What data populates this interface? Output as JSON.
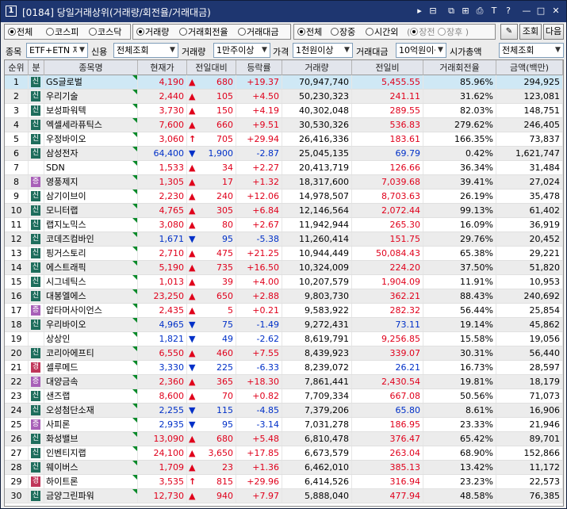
{
  "window": {
    "number": "1",
    "title": "[0184] 당일거래상위(거래량/회전율/거래대금)"
  },
  "toolbar_row1": {
    "market_options": [
      "전체",
      "코스피",
      "코스닥"
    ],
    "market_selected": 0,
    "sort_options": [
      "거래량",
      "거래회전율",
      "거래대금"
    ],
    "sort_selected": 0,
    "session_options": [
      "전체",
      "장중",
      "시간외"
    ],
    "session_selected": 0,
    "sub_session_options": [
      "장전",
      "장후"
    ],
    "query_button": "조회",
    "next_button": "다음"
  },
  "toolbar_row2": {
    "stock_label": "종목",
    "stock_value": "ETF+ETN 제",
    "credit_label": "신용",
    "credit_value": "전체조회",
    "volume_label": "거래량",
    "volume_value": "1만주이상",
    "price_label": "가격",
    "price_value": "1천원이상",
    "amount_label": "거래대금",
    "amount_value": "10억원이상",
    "cap_label": "시가총액",
    "cap_value": "전체조회"
  },
  "table": {
    "headers": [
      "순위",
      "분",
      "종목명",
      "현재가",
      "전일대비",
      "등락률",
      "거래량",
      "전일비",
      "거래회전율",
      "금액(백만)"
    ],
    "rows": [
      {
        "rank": "1",
        "type": "신",
        "name": "GS글로벌",
        "price": "4,190",
        "dir": "up",
        "change": "680",
        "rate": "+19.37",
        "volume": "70,947,740",
        "prev": "5,455.55",
        "turnover": "85.96%",
        "amount": "294,925"
      },
      {
        "rank": "2",
        "type": "신",
        "name": "우리기술",
        "price": "2,440",
        "dir": "up",
        "change": "105",
        "rate": "+4.50",
        "volume": "50,230,323",
        "prev": "241.11",
        "turnover": "31.62%",
        "amount": "123,081"
      },
      {
        "rank": "3",
        "type": "신",
        "name": "보성파워텍",
        "price": "3,730",
        "dir": "up",
        "change": "150",
        "rate": "+4.19",
        "volume": "40,302,048",
        "prev": "289.55",
        "turnover": "82.03%",
        "amount": "148,751"
      },
      {
        "rank": "4",
        "type": "신",
        "name": "엑셀세라퓨틱스",
        "price": "7,600",
        "dir": "up",
        "change": "660",
        "rate": "+9.51",
        "volume": "30,530,326",
        "prev": "536.83",
        "turnover": "279.62%",
        "amount": "246,405"
      },
      {
        "rank": "5",
        "type": "신",
        "name": "우정바이오",
        "price": "3,060",
        "dir": "uplim",
        "change": "705",
        "rate": "+29.94",
        "volume": "26,416,336",
        "prev": "183.61",
        "turnover": "166.35%",
        "amount": "73,837"
      },
      {
        "rank": "6",
        "type": "신",
        "name": "삼성전자",
        "price": "64,400",
        "dir": "down",
        "change": "1,900",
        "rate": "-2.87",
        "volume": "25,045,135",
        "prev": "69.79",
        "turnover": "0.42%",
        "amount": "1,621,747"
      },
      {
        "rank": "7",
        "type": "",
        "name": "SDN",
        "price": "1,533",
        "dir": "up",
        "change": "34",
        "rate": "+2.27",
        "volume": "20,413,719",
        "prev": "126.66",
        "turnover": "36.34%",
        "amount": "31,484"
      },
      {
        "rank": "8",
        "type": "증",
        "name": "영풍제지",
        "price": "1,305",
        "dir": "up",
        "change": "17",
        "rate": "+1.32",
        "volume": "18,317,600",
        "prev": "7,039.68",
        "turnover": "39.41%",
        "amount": "27,024"
      },
      {
        "rank": "9",
        "type": "신",
        "name": "삼기이브이",
        "price": "2,230",
        "dir": "up",
        "change": "240",
        "rate": "+12.06",
        "volume": "14,978,507",
        "prev": "8,703.63",
        "turnover": "26.19%",
        "amount": "35,478"
      },
      {
        "rank": "10",
        "type": "신",
        "name": "모니터랩",
        "price": "4,765",
        "dir": "up",
        "change": "305",
        "rate": "+6.84",
        "volume": "12,146,564",
        "prev": "2,072.44",
        "turnover": "99.13%",
        "amount": "61,402"
      },
      {
        "rank": "11",
        "type": "신",
        "name": "랩지노믹스",
        "price": "3,080",
        "dir": "up",
        "change": "80",
        "rate": "+2.67",
        "volume": "11,942,944",
        "prev": "265.30",
        "turnover": "16.09%",
        "amount": "36,919"
      },
      {
        "rank": "12",
        "type": "신",
        "name": "코데즈컴바인",
        "price": "1,671",
        "dir": "down",
        "change": "95",
        "rate": "-5.38",
        "volume": "11,260,414",
        "prev": "151.75",
        "turnover": "29.76%",
        "amount": "20,452"
      },
      {
        "rank": "13",
        "type": "신",
        "name": "핑거스토리",
        "price": "2,710",
        "dir": "up",
        "change": "475",
        "rate": "+21.25",
        "volume": "10,944,449",
        "prev": "50,084.43",
        "turnover": "65.38%",
        "amount": "29,221"
      },
      {
        "rank": "14",
        "type": "신",
        "name": "에스트래픽",
        "price": "5,190",
        "dir": "up",
        "change": "735",
        "rate": "+16.50",
        "volume": "10,324,009",
        "prev": "224.20",
        "turnover": "37.50%",
        "amount": "51,820"
      },
      {
        "rank": "15",
        "type": "신",
        "name": "시그네틱스",
        "price": "1,013",
        "dir": "up",
        "change": "39",
        "rate": "+4.00",
        "volume": "10,207,579",
        "prev": "1,904.09",
        "turnover": "11.91%",
        "amount": "10,953"
      },
      {
        "rank": "16",
        "type": "신",
        "name": "대봉엘에스",
        "price": "23,250",
        "dir": "up",
        "change": "650",
        "rate": "+2.88",
        "volume": "9,803,730",
        "prev": "362.21",
        "turnover": "88.43%",
        "amount": "240,692"
      },
      {
        "rank": "17",
        "type": "증",
        "name": "압타머사이언스",
        "price": "2,435",
        "dir": "up",
        "change": "5",
        "rate": "+0.21",
        "volume": "9,583,922",
        "prev": "282.32",
        "turnover": "56.44%",
        "amount": "25,854"
      },
      {
        "rank": "18",
        "type": "신",
        "name": "우리바이오",
        "price": "4,965",
        "dir": "down",
        "change": "75",
        "rate": "-1.49",
        "volume": "9,272,431",
        "prev": "73.11",
        "turnover": "19.14%",
        "amount": "45,862"
      },
      {
        "rank": "19",
        "type": "",
        "name": "상상인",
        "price": "1,821",
        "dir": "down",
        "change": "49",
        "rate": "-2.62",
        "volume": "8,619,791",
        "prev": "9,256.85",
        "turnover": "15.58%",
        "amount": "19,056"
      },
      {
        "rank": "20",
        "type": "신",
        "name": "코리아에프티",
        "price": "6,550",
        "dir": "up",
        "change": "460",
        "rate": "+7.55",
        "volume": "8,439,923",
        "prev": "339.07",
        "turnover": "30.31%",
        "amount": "56,440"
      },
      {
        "rank": "21",
        "type": "경",
        "name": "셀루메드",
        "price": "3,330",
        "dir": "down",
        "change": "225",
        "rate": "-6.33",
        "volume": "8,239,072",
        "prev": "26.21",
        "turnover": "16.73%",
        "amount": "28,597"
      },
      {
        "rank": "22",
        "type": "증",
        "name": "대양금속",
        "price": "2,360",
        "dir": "up",
        "change": "365",
        "rate": "+18.30",
        "volume": "7,861,441",
        "prev": "2,430.54",
        "turnover": "19.81%",
        "amount": "18,179"
      },
      {
        "rank": "23",
        "type": "신",
        "name": "샌즈랩",
        "price": "8,600",
        "dir": "up",
        "change": "70",
        "rate": "+0.82",
        "volume": "7,709,334",
        "prev": "667.08",
        "turnover": "50.56%",
        "amount": "71,073"
      },
      {
        "rank": "24",
        "type": "신",
        "name": "오성첨단소재",
        "price": "2,255",
        "dir": "down",
        "change": "115",
        "rate": "-4.85",
        "volume": "7,379,206",
        "prev": "65.80",
        "turnover": "8.61%",
        "amount": "16,906"
      },
      {
        "rank": "25",
        "type": "증",
        "name": "사피론",
        "price": "2,935",
        "dir": "down",
        "change": "95",
        "rate": "-3.14",
        "volume": "7,031,278",
        "prev": "186.95",
        "turnover": "23.33%",
        "amount": "21,946"
      },
      {
        "rank": "26",
        "type": "신",
        "name": "화성밸브",
        "price": "13,090",
        "dir": "up",
        "change": "680",
        "rate": "+5.48",
        "volume": "6,810,478",
        "prev": "376.47",
        "turnover": "65.42%",
        "amount": "89,701"
      },
      {
        "rank": "27",
        "type": "신",
        "name": "인벤티지랩",
        "price": "24,100",
        "dir": "up",
        "change": "3,650",
        "rate": "+17.85",
        "volume": "6,673,579",
        "prev": "263.04",
        "turnover": "68.90%",
        "amount": "152,866"
      },
      {
        "rank": "28",
        "type": "신",
        "name": "웨이버스",
        "price": "1,709",
        "dir": "up",
        "change": "23",
        "rate": "+1.36",
        "volume": "6,462,010",
        "prev": "385.13",
        "turnover": "13.42%",
        "amount": "11,172"
      },
      {
        "rank": "29",
        "type": "경",
        "name": "하이트론",
        "price": "3,535",
        "dir": "uplim",
        "change": "815",
        "rate": "+29.96",
        "volume": "6,414,526",
        "prev": "316.94",
        "turnover": "23.23%",
        "amount": "22,573"
      },
      {
        "rank": "30",
        "type": "신",
        "name": "금양그린파워",
        "price": "12,730",
        "dir": "up",
        "change": "940",
        "rate": "+7.97",
        "volume": "5,888,040",
        "prev": "477.94",
        "turnover": "48.58%",
        "amount": "76,385"
      }
    ]
  }
}
